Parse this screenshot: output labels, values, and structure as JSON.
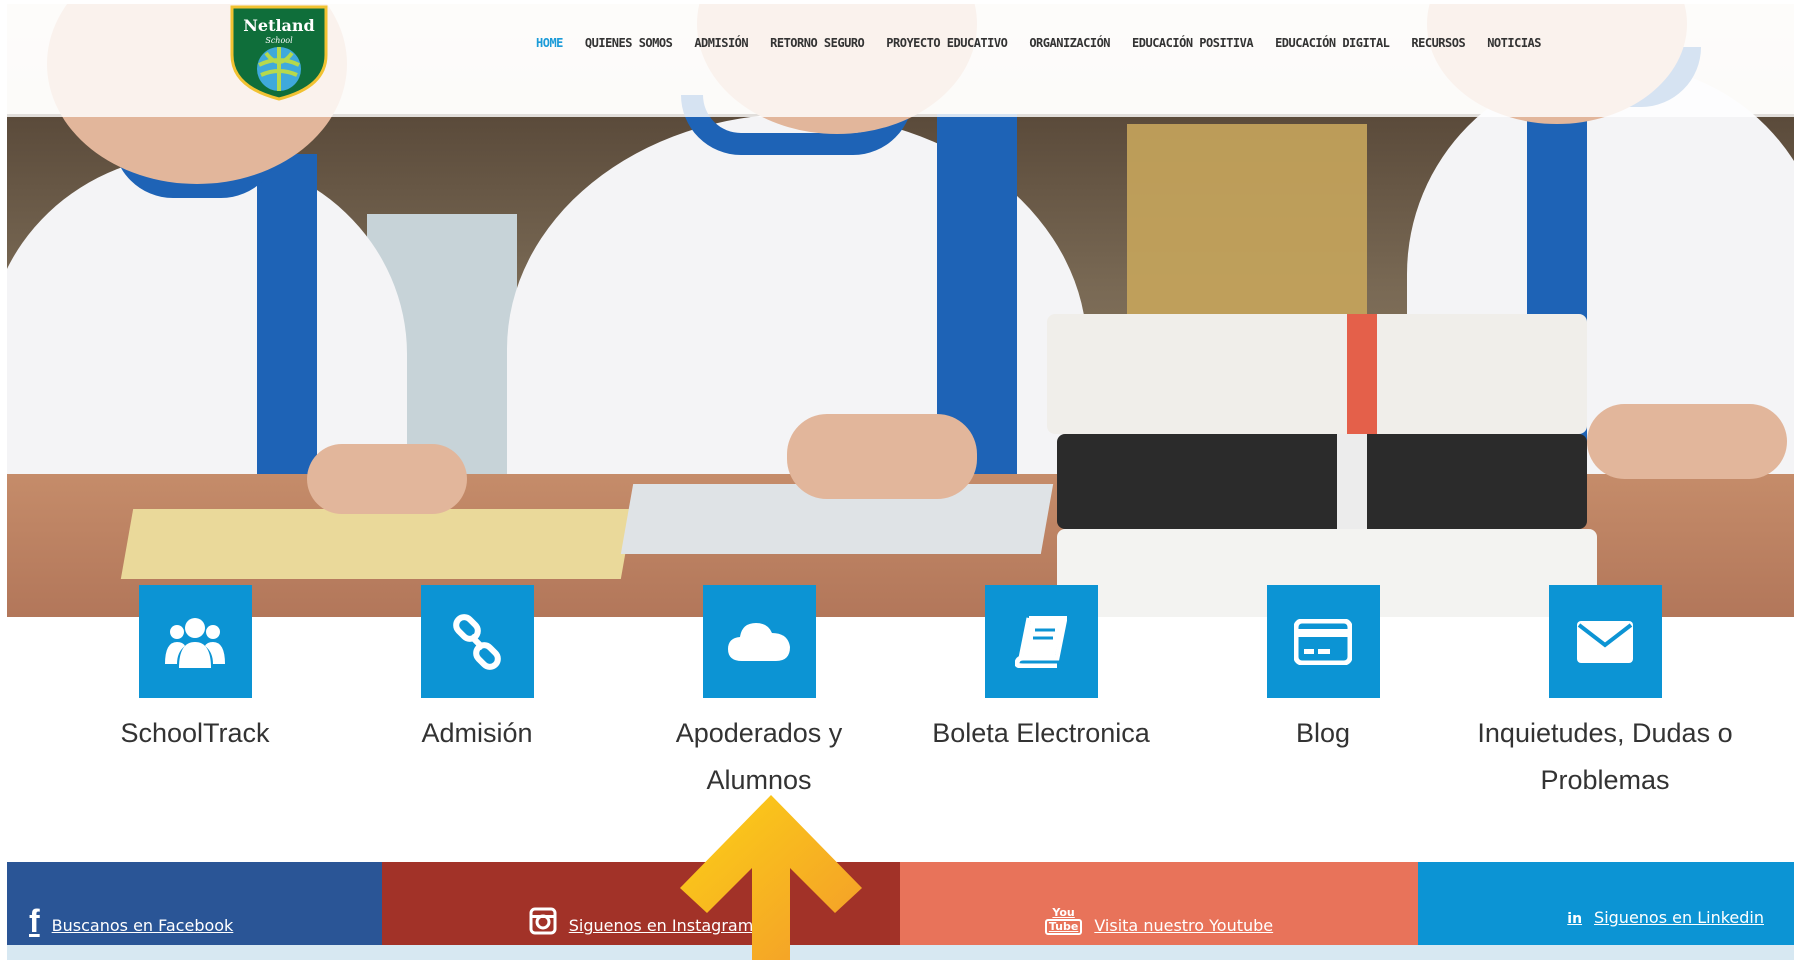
{
  "header": {
    "logo_text": "Netland",
    "logo_sub": "School",
    "nav": [
      {
        "label": "HOME",
        "active": true
      },
      {
        "label": "QUIENES SOMOS"
      },
      {
        "label": "ADMISIÓN"
      },
      {
        "label": "RETORNO SEGURO"
      },
      {
        "label": "PROYECTO EDUCATIVO"
      },
      {
        "label": "ORGANIZACIÓN"
      },
      {
        "label": "EDUCACIÓN POSITIVA"
      },
      {
        "label": "EDUCACIÓN DIGITAL"
      },
      {
        "label": "RECURSOS"
      },
      {
        "label": "NOTICIAS"
      }
    ]
  },
  "quick_links": [
    {
      "label": "SchoolTrack",
      "icon": "users-icon"
    },
    {
      "label": "Admisión",
      "icon": "link-icon"
    },
    {
      "label": "Apoderados y Alumnos",
      "icon": "cloud-icon"
    },
    {
      "label": "Boleta Electronica",
      "icon": "book-icon"
    },
    {
      "label": "Blog",
      "icon": "credit-card-icon"
    },
    {
      "label": "Inquietudes, Dudas o Problemas",
      "icon": "envelope-icon"
    }
  ],
  "social": {
    "facebook": "Buscanos en Facebook",
    "instagram": "Siguenos en Instagram",
    "youtube": "Visita nuestro Youtube",
    "linkedin": "Siguenos en Linkedin",
    "youtube_icon_top": "You",
    "youtube_icon_bottom": "Tube",
    "linkedin_icon": "in"
  },
  "colors": {
    "accent": "#0c94d4",
    "facebook": "#2a5596",
    "instagram": "#a23228",
    "youtube": "#e8735a",
    "linkedin": "#0c94d4",
    "arrow": "#f7b52a"
  }
}
